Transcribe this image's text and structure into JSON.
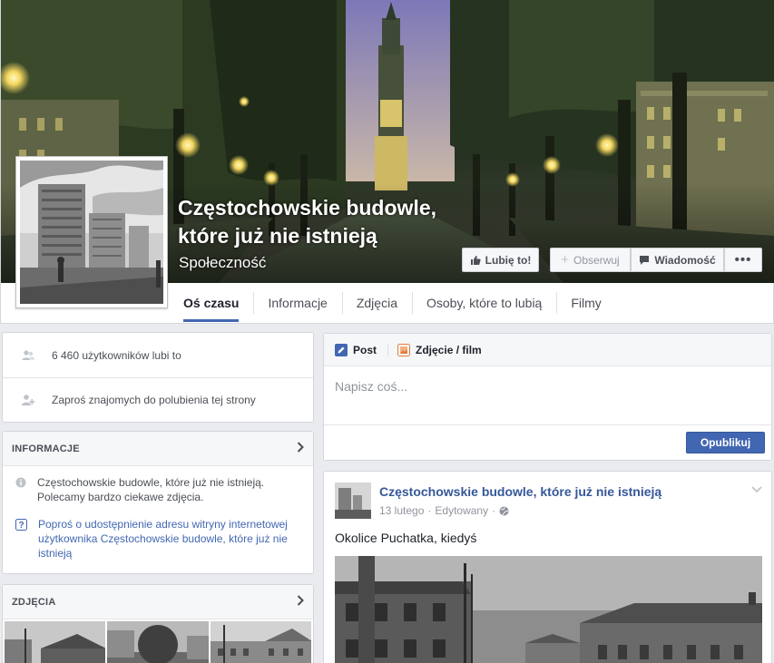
{
  "page": {
    "name": "Częstochowskie budowle, które już nie istnieją",
    "category": "Społeczność"
  },
  "actions": {
    "like": "Lubię to!",
    "follow": "Obserwuj",
    "message": "Wiadomość",
    "more": "•••"
  },
  "tabs": [
    {
      "label": "Oś czasu",
      "active": true
    },
    {
      "label": "Informacje"
    },
    {
      "label": "Zdjęcia"
    },
    {
      "label": "Osoby, które to lubią"
    },
    {
      "label": "Filmy"
    }
  ],
  "likes": {
    "count_text": "6 460 użytkowników lubi to",
    "invite_text": "Zaproś znajomych do polubienia tej strony"
  },
  "about": {
    "header": "INFORMACJE",
    "description": "Częstochowskie budowle, które już nie istnieją. Polecamy bardzo ciekawe zdjęcia.",
    "request_link": "Poproś o udostępnienie adresu witryny internetowej użytkownika Częstochowskie budowle, które już nie istnieją"
  },
  "photos": {
    "header": "ZDJĘCIA"
  },
  "composer": {
    "tab_post": "Post",
    "tab_photo": "Zdjęcie / film",
    "placeholder": "Napisz coś...",
    "publish": "Opublikuj"
  },
  "post": {
    "author": "Częstochowskie budowle, które już nie istnieją",
    "date": "13 lutego",
    "separator": "·",
    "edited": "Edytowany",
    "separator2": "·",
    "text": "Okolice Puchatka, kiedyś"
  },
  "colors": {
    "accent": "#4267b2",
    "link": "#365899",
    "background": "#e9ebee"
  }
}
